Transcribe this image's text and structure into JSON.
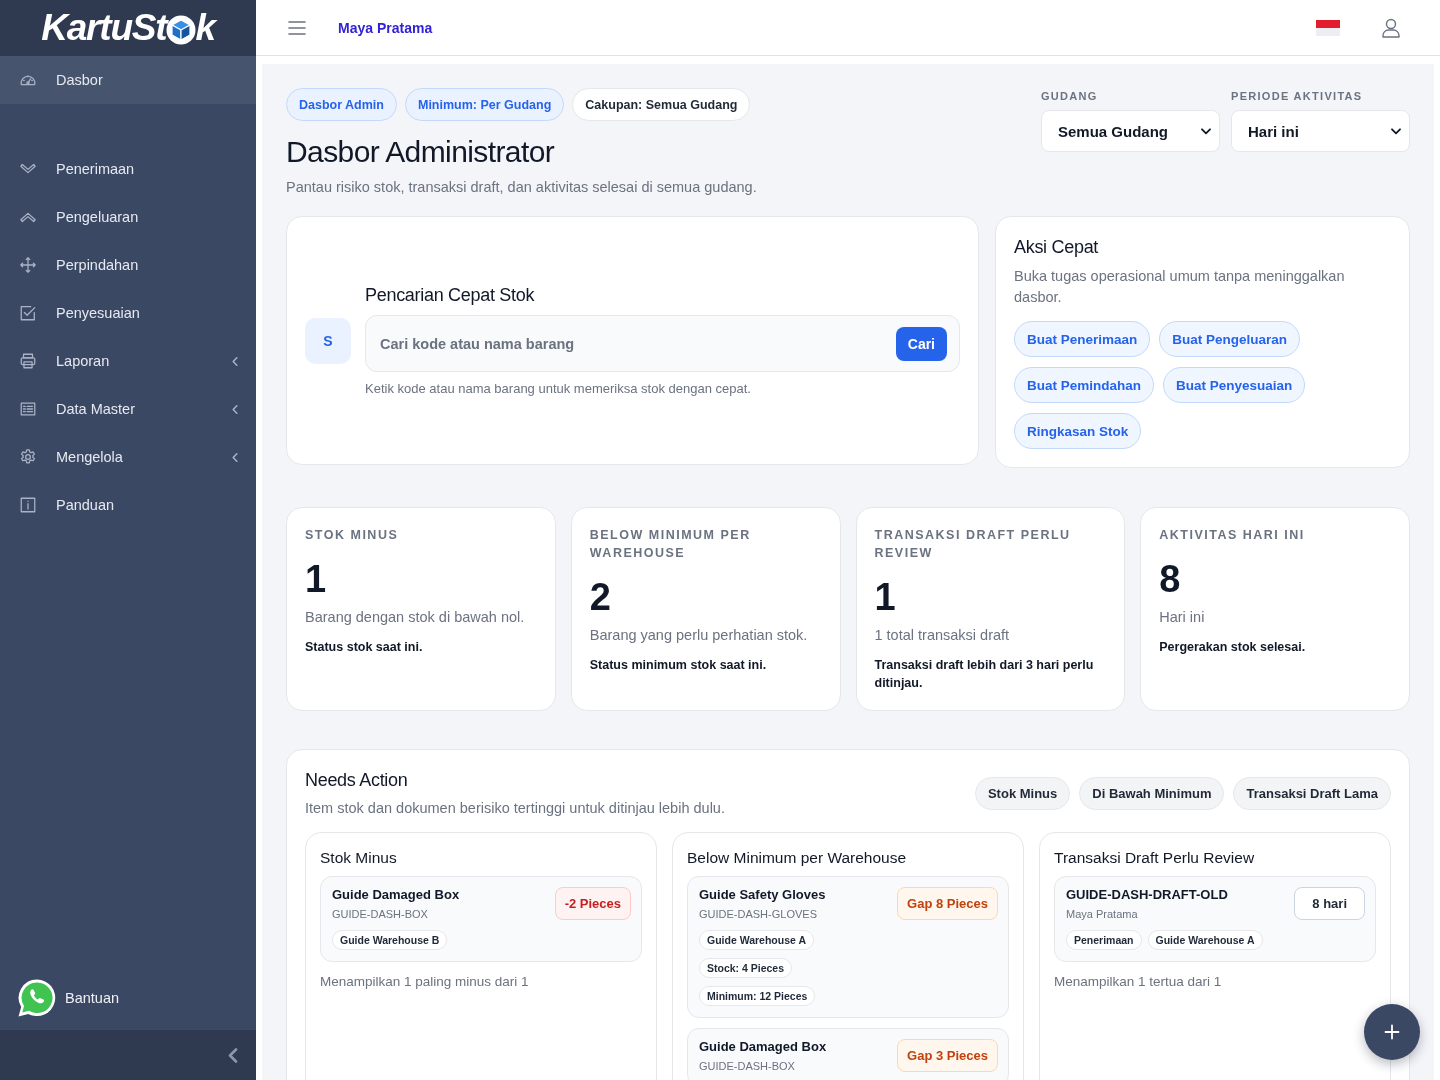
{
  "sidebar": {
    "logo": {
      "text_before_icon": "KartuSt",
      "text_after_icon": "k"
    },
    "items": [
      {
        "label": "Dasbor",
        "selected": true,
        "has_submenu": false
      },
      {
        "label": "Penerimaan",
        "selected": false,
        "has_submenu": false
      },
      {
        "label": "Pengeluaran",
        "selected": false,
        "has_submenu": false
      },
      {
        "label": "Perpindahan",
        "selected": false,
        "has_submenu": false
      },
      {
        "label": "Penyesuaian",
        "selected": false,
        "has_submenu": false
      },
      {
        "label": "Laporan",
        "selected": false,
        "has_submenu": true
      },
      {
        "label": "Data Master",
        "selected": false,
        "has_submenu": true
      },
      {
        "label": "Mengelola",
        "selected": false,
        "has_submenu": true
      },
      {
        "label": "Panduan",
        "selected": false,
        "has_submenu": false
      }
    ],
    "help": {
      "label": "Bantuan"
    }
  },
  "topbar": {
    "user_name": "Maya Pratama"
  },
  "header": {
    "tags": [
      {
        "label": "Dasbor Admin",
        "kind": "info"
      },
      {
        "label": "Minimum: Per Gudang",
        "kind": "info"
      },
      {
        "label": "Cakupan: Semua Gudang",
        "kind": "neutral"
      }
    ],
    "title": "Dasbor Administrator",
    "subtitle": "Pantau risiko stok, transaksi draft, dan aktivitas selesai di semua gudang.",
    "filters": [
      {
        "label": "GUDANG",
        "value": "Semua Gudang"
      },
      {
        "label": "PERIODE AKTIVITAS",
        "value": "Hari ini"
      }
    ]
  },
  "quick_search": {
    "avatar": "S",
    "title": "Pencarian Cepat Stok",
    "placeholder": "Cari kode atau nama barang",
    "button": "Cari",
    "help": "Ketik kode atau nama barang untuk memeriksa stok dengan cepat."
  },
  "quick_actions": {
    "title": "Aksi Cepat",
    "description": "Buka tugas operasional umum tanpa meninggalkan dasbor.",
    "buttons": [
      "Buat Penerimaan",
      "Buat Pengeluaran",
      "Buat Pemindahan",
      "Buat Penyesuaian",
      "Ringkasan Stok"
    ]
  },
  "stats": [
    {
      "label": "STOK MINUS",
      "value": "1",
      "description": "Barang dengan stok di bawah nol.",
      "note": "Status stok saat ini."
    },
    {
      "label": "BELOW MINIMUM PER WAREHOUSE",
      "value": "2",
      "description": "Barang yang perlu perhatian stok.",
      "note": "Status minimum stok saat ini."
    },
    {
      "label": "TRANSAKSI DRAFT PERLU REVIEW",
      "value": "1",
      "description": "1 total transaksi draft",
      "note": "Transaksi draft lebih dari 3 hari perlu ditinjau."
    },
    {
      "label": "AKTIVITAS HARI INI",
      "value": "8",
      "description": "Hari ini",
      "note": "Pergerakan stok selesai."
    }
  ],
  "needs_action": {
    "title": "Needs Action",
    "description": "Item stok dan dokumen berisiko tertinggi untuk ditinjau lebih dulu.",
    "filters": [
      "Stok Minus",
      "Di Bawah Minimum",
      "Transaksi Draft Lama"
    ],
    "columns": [
      {
        "title": "Stok Minus",
        "items": [
          {
            "kind": "danger",
            "name": "Guide Damaged Box",
            "code": "GUIDE-DASH-BOX",
            "badge": "-2 Pieces",
            "tags": [
              "Guide Warehouse B"
            ]
          }
        ],
        "footer": "Menampilkan 1 paling minus dari 1"
      },
      {
        "title": "Below Minimum per Warehouse",
        "items": [
          {
            "kind": "warning",
            "name": "Guide Safety Gloves",
            "code": "GUIDE-DASH-GLOVES",
            "badge": "Gap 8 Pieces",
            "tags": [
              "Guide Warehouse A",
              "Stock: 4 Pieces",
              "Minimum: 12 Pieces"
            ]
          },
          {
            "kind": "warning",
            "name": "Guide Damaged Box",
            "code": "GUIDE-DASH-BOX",
            "badge": "Gap 3 Pieces"
          }
        ]
      },
      {
        "title": "Transaksi Draft Perlu Review",
        "items": [
          {
            "kind": "neutral",
            "name": "GUIDE-DASH-DRAFT-OLD",
            "code": "Maya Pratama",
            "badge": "8 hari",
            "tags": [
              "Penerimaan",
              "Guide Warehouse A"
            ]
          }
        ],
        "footer": "Menampilkan 1 tertua dari 1"
      }
    ]
  }
}
